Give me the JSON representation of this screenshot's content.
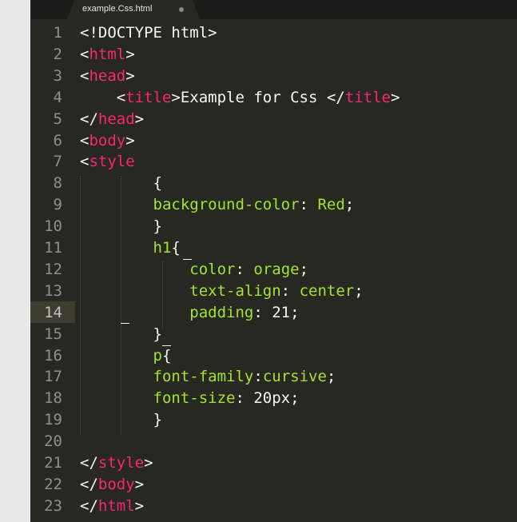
{
  "tab": {
    "filename": "example.Css.html",
    "modified_icon": "unsaved-dot-icon"
  },
  "theme": {
    "background": "#272822",
    "tag_color": "#f92672",
    "property_color": "#a6e22e",
    "text_color": "#f8f8f2",
    "line_number_color": "#8f908a"
  },
  "editor": {
    "current_line": 14,
    "lines": [
      {
        "n": "1",
        "tokens": [
          {
            "t": "<!DOCTYPE html>",
            "c": "plain"
          }
        ]
      },
      {
        "n": "2",
        "tokens": [
          {
            "t": "<",
            "c": "plain"
          },
          {
            "t": "html",
            "c": "tag"
          },
          {
            "t": ">",
            "c": "plain"
          }
        ]
      },
      {
        "n": "3",
        "tokens": [
          {
            "t": "<",
            "c": "plain"
          },
          {
            "t": "head",
            "c": "tag"
          },
          {
            "t": ">",
            "c": "plain"
          }
        ]
      },
      {
        "n": "4",
        "tokens": [
          {
            "t": "    <",
            "c": "plain"
          },
          {
            "t": "title",
            "c": "tag"
          },
          {
            "t": ">Example for Css </",
            "c": "plain"
          },
          {
            "t": "title",
            "c": "tag"
          },
          {
            "t": ">",
            "c": "plain"
          }
        ]
      },
      {
        "n": "5",
        "tokens": [
          {
            "t": "</",
            "c": "plain"
          },
          {
            "t": "head",
            "c": "tag"
          },
          {
            "t": ">",
            "c": "plain"
          }
        ]
      },
      {
        "n": "6",
        "tokens": [
          {
            "t": "<",
            "c": "plain"
          },
          {
            "t": "body",
            "c": "tag"
          },
          {
            "t": ">",
            "c": "plain"
          }
        ]
      },
      {
        "n": "7",
        "tokens": [
          {
            "t": "<",
            "c": "plain"
          },
          {
            "t": "style",
            "c": "tag"
          }
        ]
      },
      {
        "n": "8",
        "tokens": [
          {
            "t": "        {",
            "c": "plain"
          }
        ]
      },
      {
        "n": "9",
        "tokens": [
          {
            "t": "        ",
            "c": "plain"
          },
          {
            "t": "background-color",
            "c": "prop"
          },
          {
            "t": ": ",
            "c": "plain"
          },
          {
            "t": "Red",
            "c": "prop"
          },
          {
            "t": ";",
            "c": "plain"
          }
        ]
      },
      {
        "n": "10",
        "tokens": [
          {
            "t": "        }",
            "c": "plain"
          }
        ]
      },
      {
        "n": "11",
        "tokens": [
          {
            "t": "        ",
            "c": "plain"
          },
          {
            "t": "h1",
            "c": "prop"
          },
          {
            "t": "{",
            "c": "plain"
          }
        ]
      },
      {
        "n": "12",
        "tokens": [
          {
            "t": "            ",
            "c": "plain"
          },
          {
            "t": "color",
            "c": "prop"
          },
          {
            "t": ": ",
            "c": "plain"
          },
          {
            "t": "orage",
            "c": "prop"
          },
          {
            "t": ";",
            "c": "plain"
          }
        ]
      },
      {
        "n": "13",
        "tokens": [
          {
            "t": "            ",
            "c": "plain"
          },
          {
            "t": "text-align",
            "c": "prop"
          },
          {
            "t": ": ",
            "c": "plain"
          },
          {
            "t": "center",
            "c": "prop"
          },
          {
            "t": ";",
            "c": "plain"
          }
        ]
      },
      {
        "n": "14",
        "tokens": [
          {
            "t": "            ",
            "c": "plain"
          },
          {
            "t": "padding",
            "c": "prop"
          },
          {
            "t": ": 21;",
            "c": "plain"
          }
        ]
      },
      {
        "n": "15",
        "tokens": [
          {
            "t": "        }",
            "c": "plain"
          }
        ]
      },
      {
        "n": "16",
        "tokens": [
          {
            "t": "        ",
            "c": "plain"
          },
          {
            "t": "p",
            "c": "prop"
          },
          {
            "t": "{",
            "c": "plain"
          }
        ]
      },
      {
        "n": "17",
        "tokens": [
          {
            "t": "        ",
            "c": "plain"
          },
          {
            "t": "font-family",
            "c": "prop"
          },
          {
            "t": ":",
            "c": "plain"
          },
          {
            "t": "cursive",
            "c": "prop"
          },
          {
            "t": ";",
            "c": "plain"
          }
        ]
      },
      {
        "n": "18",
        "tokens": [
          {
            "t": "        ",
            "c": "plain"
          },
          {
            "t": "font-size",
            "c": "prop"
          },
          {
            "t": ": 20px;",
            "c": "plain"
          }
        ]
      },
      {
        "n": "19",
        "tokens": [
          {
            "t": "        }",
            "c": "plain"
          }
        ]
      },
      {
        "n": "20",
        "tokens": []
      },
      {
        "n": "21",
        "tokens": [
          {
            "t": "</",
            "c": "plain"
          },
          {
            "t": "style",
            "c": "tag"
          },
          {
            "t": ">",
            "c": "plain"
          }
        ]
      },
      {
        "n": "22",
        "tokens": [
          {
            "t": "</",
            "c": "plain"
          },
          {
            "t": "body",
            "c": "tag"
          },
          {
            "t": ">",
            "c": "plain"
          }
        ]
      },
      {
        "n": "23",
        "tokens": [
          {
            "t": "</",
            "c": "plain"
          },
          {
            "t": "html",
            "c": "tag"
          },
          {
            "t": ">",
            "c": "plain"
          }
        ]
      }
    ]
  }
}
